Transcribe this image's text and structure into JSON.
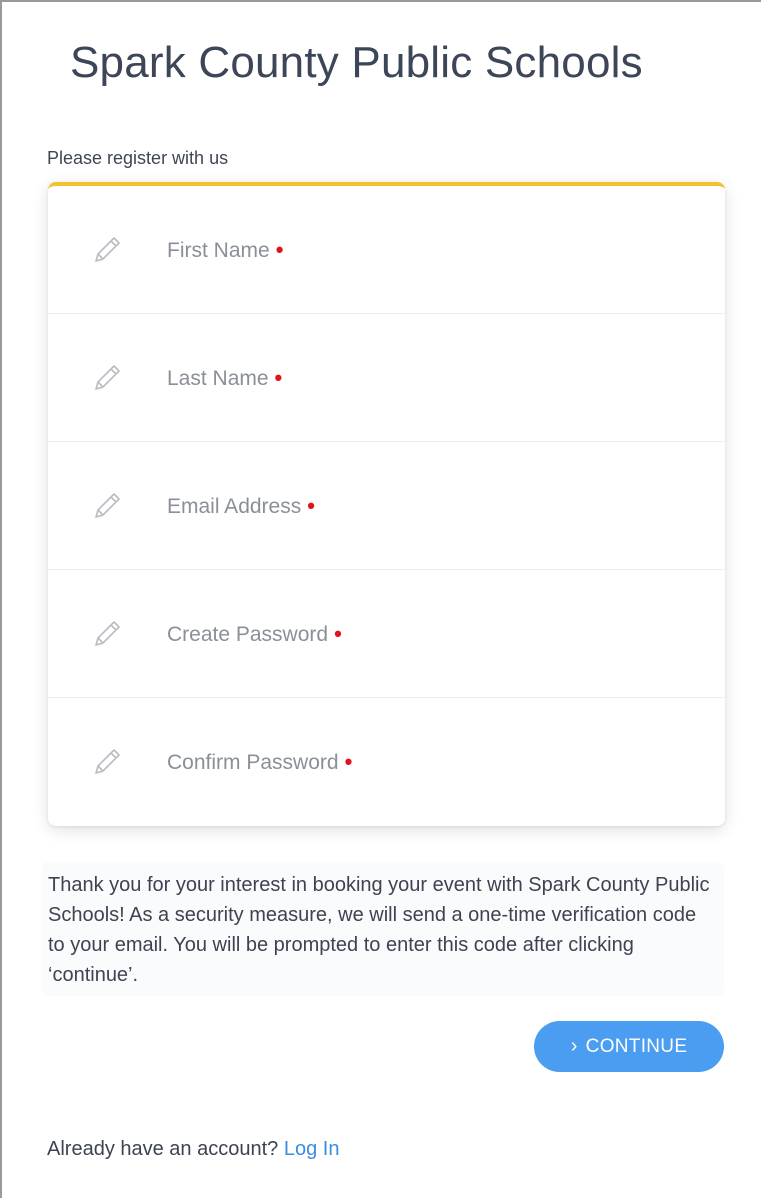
{
  "header": {
    "title": "Spark County Public Schools",
    "subtitle": "Please register with us"
  },
  "form": {
    "fields": [
      {
        "label": "First Name",
        "required_mark": "•",
        "icon": "pencil-icon"
      },
      {
        "label": "Last Name",
        "required_mark": "•",
        "icon": "pencil-icon"
      },
      {
        "label": "Email Address",
        "required_mark": "•",
        "icon": "pencil-icon"
      },
      {
        "label": "Create Password",
        "required_mark": "•",
        "icon": "pencil-icon"
      },
      {
        "label": "Confirm Password",
        "required_mark": "•",
        "icon": "pencil-icon"
      }
    ]
  },
  "info": {
    "text": "Thank you for your interest in booking your event with Spark County Public Schools! As a security measure, we will send a one-time verification code to your email. You will be prompted to enter this code after clicking ‘continue’."
  },
  "actions": {
    "continue_icon": "›",
    "continue_label": "CONTINUE"
  },
  "footer": {
    "prompt": "Already have an account?",
    "login_link": "Log In"
  },
  "colors": {
    "accent_top_border": "#f2c12e",
    "button": "#4a9df0",
    "required": "#e3101e",
    "link": "#3b8de0"
  }
}
